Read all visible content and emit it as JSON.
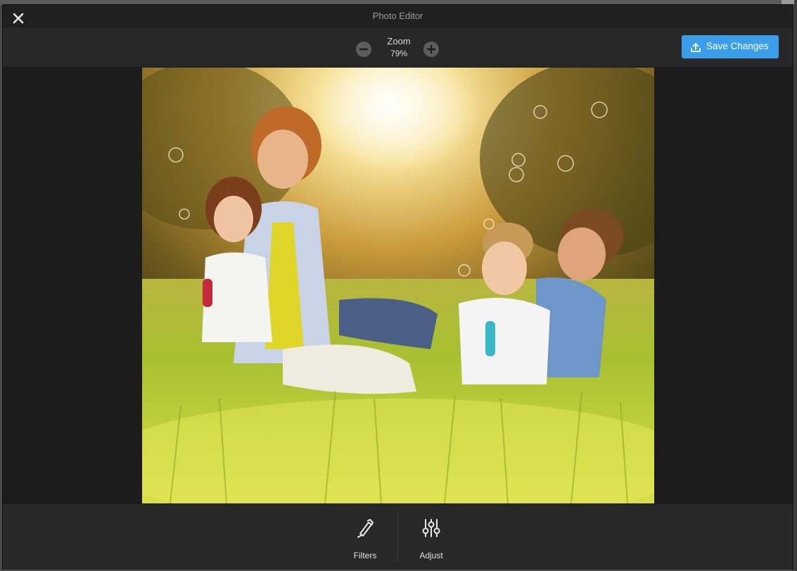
{
  "window": {
    "title": "Photo Editor"
  },
  "toolbar": {
    "zoom_label": "Zoom",
    "zoom_value": "79%",
    "zoom_out_icon": "minus-circle-icon",
    "zoom_in_icon": "plus-circle-icon",
    "save_label": "Save Changes",
    "save_icon": "upload-icon"
  },
  "photo": {
    "alt": "Family sitting in sunny grass blowing bubbles"
  },
  "tools": [
    {
      "label": "Filters",
      "icon": "brush-icon"
    },
    {
      "label": "Adjust",
      "icon": "sliders-icon"
    }
  ],
  "colors": {
    "accent": "#3a9ee8",
    "modal_bg": "#1c1c1c",
    "bar_bg": "#282828"
  }
}
